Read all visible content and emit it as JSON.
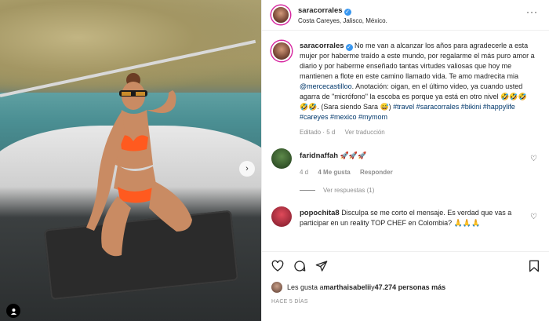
{
  "post": {
    "username": "saracorrales",
    "location": "Costa Careyes, Jalisco, México."
  },
  "caption": {
    "username": "saracorrales",
    "text_1": " No me van a alcanzar los años para agradecerle a esta mujer por haberme traído a este mundo, por regalarme el más puro amor a diario y por haberme enseñado tantas virtudes valiosas que hoy me mantienen a flote en este camino llamado vida. Te amo madrecita mia ",
    "mention": "@mercecastilloo",
    "text_2": ". Anotación: oigan, en el último video, ya cuando usted agarra de \"micrófono\" la escoba es porque ya está en otro nivel 🤣🤣🤣🤣🤣. (Sara siendo Sara 😅) ",
    "hashtags": "#travel #saracorrales #bikini #happylife #careyes #mexico #mymom",
    "edited": "Editado · 5 d",
    "see_translation": "Ver traducción"
  },
  "comments": [
    {
      "username": "faridnaffah",
      "text": "🚀🚀🚀",
      "age": "4 d",
      "likes": "4 Me gusta",
      "reply": "Responder",
      "view_replies": "Ver respuestas (1)"
    },
    {
      "username": "popochita8",
      "text": "Disculpa se me corto el mensaje. Es verdad que vas a participar en un reality TOP CHEF en Colombia? 🙏🙏🙏"
    }
  ],
  "likes": {
    "prefix": "Les gusta a ",
    "first_user": "marthaisabelii",
    "middle": " y ",
    "others": "47.274 personas más"
  },
  "timestamp": "HACE 5 DÍAS",
  "icons": {
    "more": "more-icon",
    "heart": "heart-icon",
    "comment": "comment-icon",
    "share": "share-icon",
    "save": "bookmark-icon",
    "next": "chevron-right-icon"
  },
  "colors": {
    "verified": "#3897f0",
    "link": "#00376b",
    "muted": "#8e8e8e",
    "story_ring": "#d6249f"
  }
}
